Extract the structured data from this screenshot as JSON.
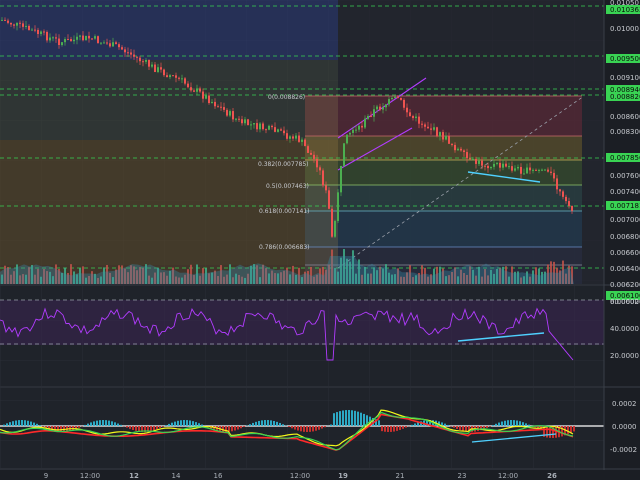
{
  "colors": {
    "background": "#1b1e24",
    "candle_up": "#4caf50",
    "candle_down": "#ef5350",
    "green_line": "#39d353",
    "purple": "#b23cff",
    "cyan": "#4fd1ff",
    "yellow": "#f4f71a",
    "red": "#ff2a2a"
  },
  "price_axis": {
    "labels": [
      "0.01050",
      "0.010363",
      "0.01000",
      "0.009500",
      "0.009100",
      "0.008940",
      "0.008826",
      "0.008600",
      "0.008300",
      "0.007856",
      "0.007600",
      "0.007400",
      "0.007181",
      "0.007000",
      "0.006800",
      "0.006600",
      "0.006400",
      "0.006200",
      "0.006100",
      "0.006020"
    ],
    "highlighted": [
      "0.010363",
      "0.009500",
      "0.008940",
      "0.008826",
      "0.007856",
      "0.007181",
      "0.006100"
    ]
  },
  "rsi_axis": {
    "labels": [
      "60.0000",
      "40.0000",
      "20.0000"
    ]
  },
  "macd_axis": {
    "labels": [
      "0.0002",
      "0.0000",
      "-0.0002"
    ]
  },
  "time_axis": {
    "labels": [
      "9",
      "12:00",
      "12",
      "14",
      "16",
      "12:00",
      "19",
      "21",
      "23",
      "12:00",
      "26"
    ],
    "bold": [
      "12",
      "19",
      "26"
    ]
  },
  "fib_levels": [
    {
      "label": "0(0.008826)"
    },
    {
      "label": "0.382(0.007785)"
    },
    {
      "label": "0.5(0.007463)"
    },
    {
      "label": "0.618(0.007141)"
    },
    {
      "label": "0.786(0.006683)"
    }
  ]
}
